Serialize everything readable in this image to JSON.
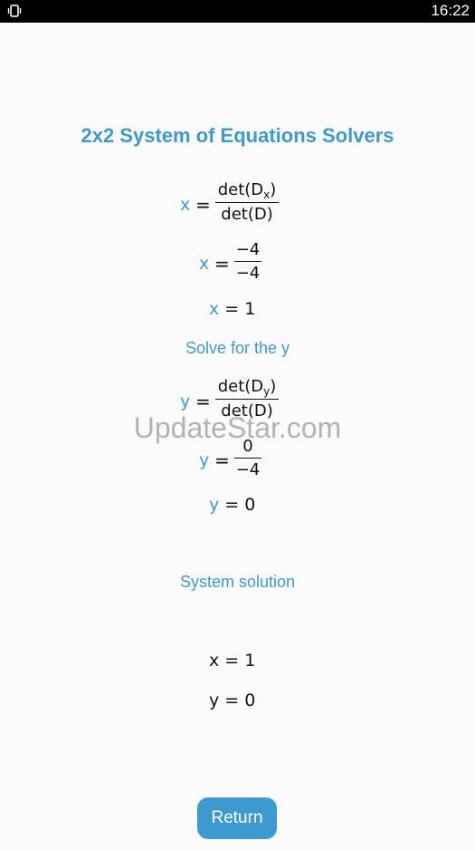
{
  "status_bar": {
    "time": "16:22"
  },
  "title": "2x2 System of Equations Solvers",
  "x_section": {
    "var": "x",
    "formula_num": "det(D",
    "formula_num_sub": "x",
    "formula_num_end": ")",
    "formula_den": "det(D)",
    "frac_num": "−4",
    "frac_den": "−4",
    "result": "1"
  },
  "y_header": "Solve for the y",
  "y_section": {
    "var": "y",
    "formula_num": "det(D",
    "formula_num_sub": "y",
    "formula_num_end": ")",
    "formula_den": "det(D)",
    "frac_num": "0",
    "frac_den": "−4",
    "result": "0"
  },
  "solution_header": "System solution",
  "solution": {
    "x_label": "x",
    "x_value": "1",
    "y_label": "y",
    "y_value": "0"
  },
  "equals": "=",
  "watermark": "UpdateStar.com",
  "return_label": "Return"
}
